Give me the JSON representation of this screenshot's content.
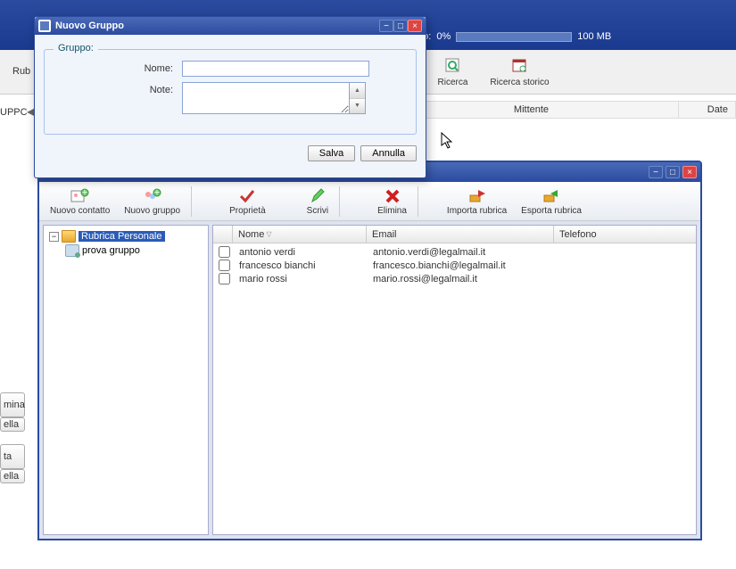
{
  "header": {
    "storage_label": "zzato:",
    "storage_percent": "0%",
    "storage_total": "100 MB"
  },
  "top_toolbar": {
    "rub_label": "Rub",
    "ricerca": "Ricerca",
    "ricerca_storico": "Ricerca storico"
  },
  "left_sidebar": {
    "uppc": "UPPC",
    "mina": "mina",
    "ella": "ella",
    "ta": "ta"
  },
  "cols": {
    "mittente": "Mittente",
    "date": "Date"
  },
  "address_book": {
    "toolbar": {
      "nuovo_contatto": "Nuovo contatto",
      "nuovo_gruppo": "Nuovo gruppo",
      "proprieta": "Proprietà",
      "scrivi": "Scrivi",
      "elimina": "Elimina",
      "importa": "Importa rubrica",
      "esporta": "Esporta rubrica"
    },
    "tree": {
      "root": "Rubrica Personale",
      "child": "prova gruppo"
    },
    "columns": {
      "nome": "Nome",
      "email": "Email",
      "telefono": "Telefono"
    },
    "contacts": [
      {
        "name": "antonio verdi",
        "email": "antonio.verdi@legalmail.it",
        "phone": ""
      },
      {
        "name": "francesco bianchi",
        "email": "francesco.bianchi@legalmail.it",
        "phone": ""
      },
      {
        "name": "mario rossi",
        "email": "mario.rossi@legalmail.it",
        "phone": ""
      }
    ]
  },
  "dialog": {
    "title": "Nuovo Gruppo",
    "legend": "Gruppo:",
    "nome_label": "Nome:",
    "note_label": "Note:",
    "nome_value": "",
    "note_value": "",
    "save": "Salva",
    "cancel": "Annulla"
  }
}
